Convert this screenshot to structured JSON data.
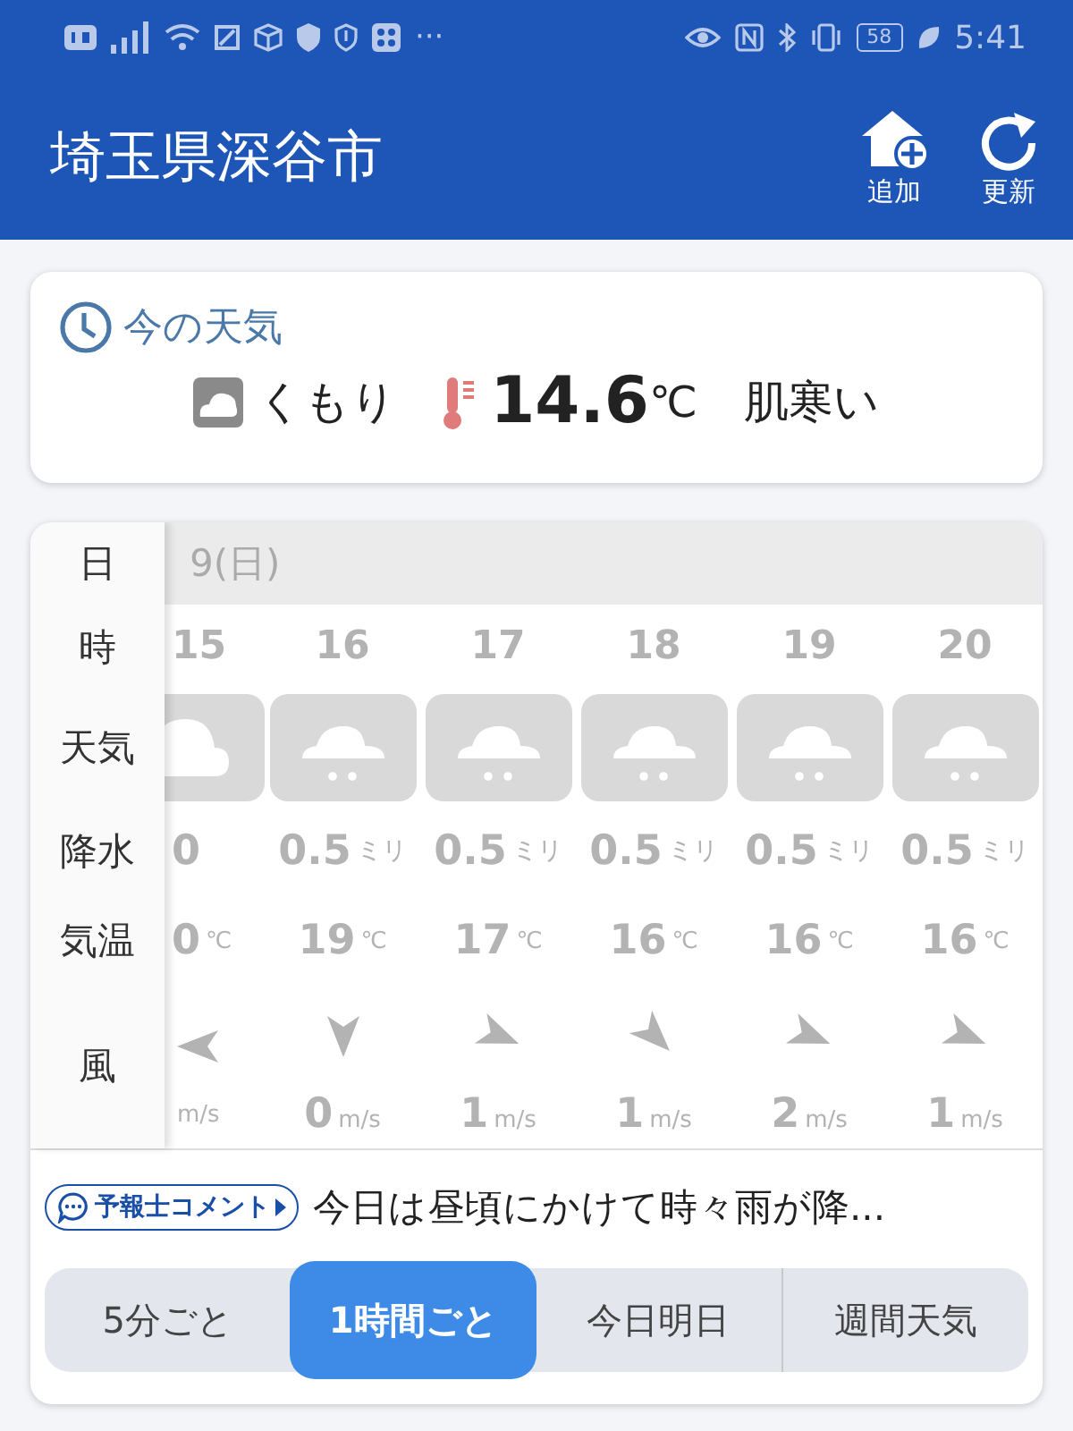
{
  "status_bar": {
    "more": "···",
    "battery": "58",
    "time": "5:41"
  },
  "header": {
    "title": "埼玉県深谷市",
    "actions": [
      {
        "kind": "add-home",
        "label": "追加"
      },
      {
        "kind": "refresh",
        "label": "更新"
      }
    ]
  },
  "current": {
    "heading": "今の天気",
    "icon": {
      "kind": "cloudy"
    },
    "condition": "くもり",
    "temperature": "14.6",
    "unit": "℃",
    "feeling": "肌寒い"
  },
  "hourly": {
    "row_labels": [
      "日",
      "時",
      "天気",
      "降水",
      "気温",
      "風"
    ],
    "date": "9(日)",
    "hours": [
      {
        "hour": "15",
        "icon": {
          "kind": "cloudy"
        },
        "precip": "0",
        "temp": "0",
        "temp_unit": "℃",
        "wind_arrow": {
          "kind": "W"
        },
        "speed_unit": "m/s"
      },
      {
        "hour": "16",
        "icon": {
          "kind": "rain"
        },
        "precip": "0.5",
        "precip_unit": "ミリ",
        "temp": "19",
        "temp_unit": "℃",
        "wind_arrow": {
          "kind": "S"
        },
        "speed": "0",
        "speed_unit": "m/s"
      },
      {
        "hour": "17",
        "icon": {
          "kind": "rain"
        },
        "precip": "0.5",
        "precip_unit": "ミリ",
        "temp": "17",
        "temp_unit": "℃",
        "wind_arrow": {
          "kind": "ESE"
        },
        "speed": "1",
        "speed_unit": "m/s"
      },
      {
        "hour": "18",
        "icon": {
          "kind": "rain"
        },
        "precip": "0.5",
        "precip_unit": "ミリ",
        "temp": "16",
        "temp_unit": "℃",
        "wind_arrow": {
          "kind": "SE"
        },
        "speed": "1",
        "speed_unit": "m/s"
      },
      {
        "hour": "19",
        "icon": {
          "kind": "rain"
        },
        "precip": "0.5",
        "precip_unit": "ミリ",
        "temp": "16",
        "temp_unit": "℃",
        "wind_arrow": {
          "kind": "ESE"
        },
        "speed": "2",
        "speed_unit": "m/s"
      },
      {
        "hour": "20",
        "icon": {
          "kind": "rain"
        },
        "precip": "0.5",
        "precip_unit": "ミリ",
        "temp": "16",
        "temp_unit": "℃",
        "wind_arrow": {
          "kind": "ESE"
        },
        "speed": "1",
        "speed_unit": "m/s"
      }
    ]
  },
  "comment": {
    "badge": "予報士コメント",
    "text": "今日は昼頃にかけて時々雨が降..."
  },
  "tabs": [
    {
      "label": "5分ごと",
      "selected": false
    },
    {
      "label": "1時間ごと",
      "selected": true
    },
    {
      "label": "今日明日",
      "selected": false
    },
    {
      "label": "週間天気",
      "selected": false
    }
  ]
}
